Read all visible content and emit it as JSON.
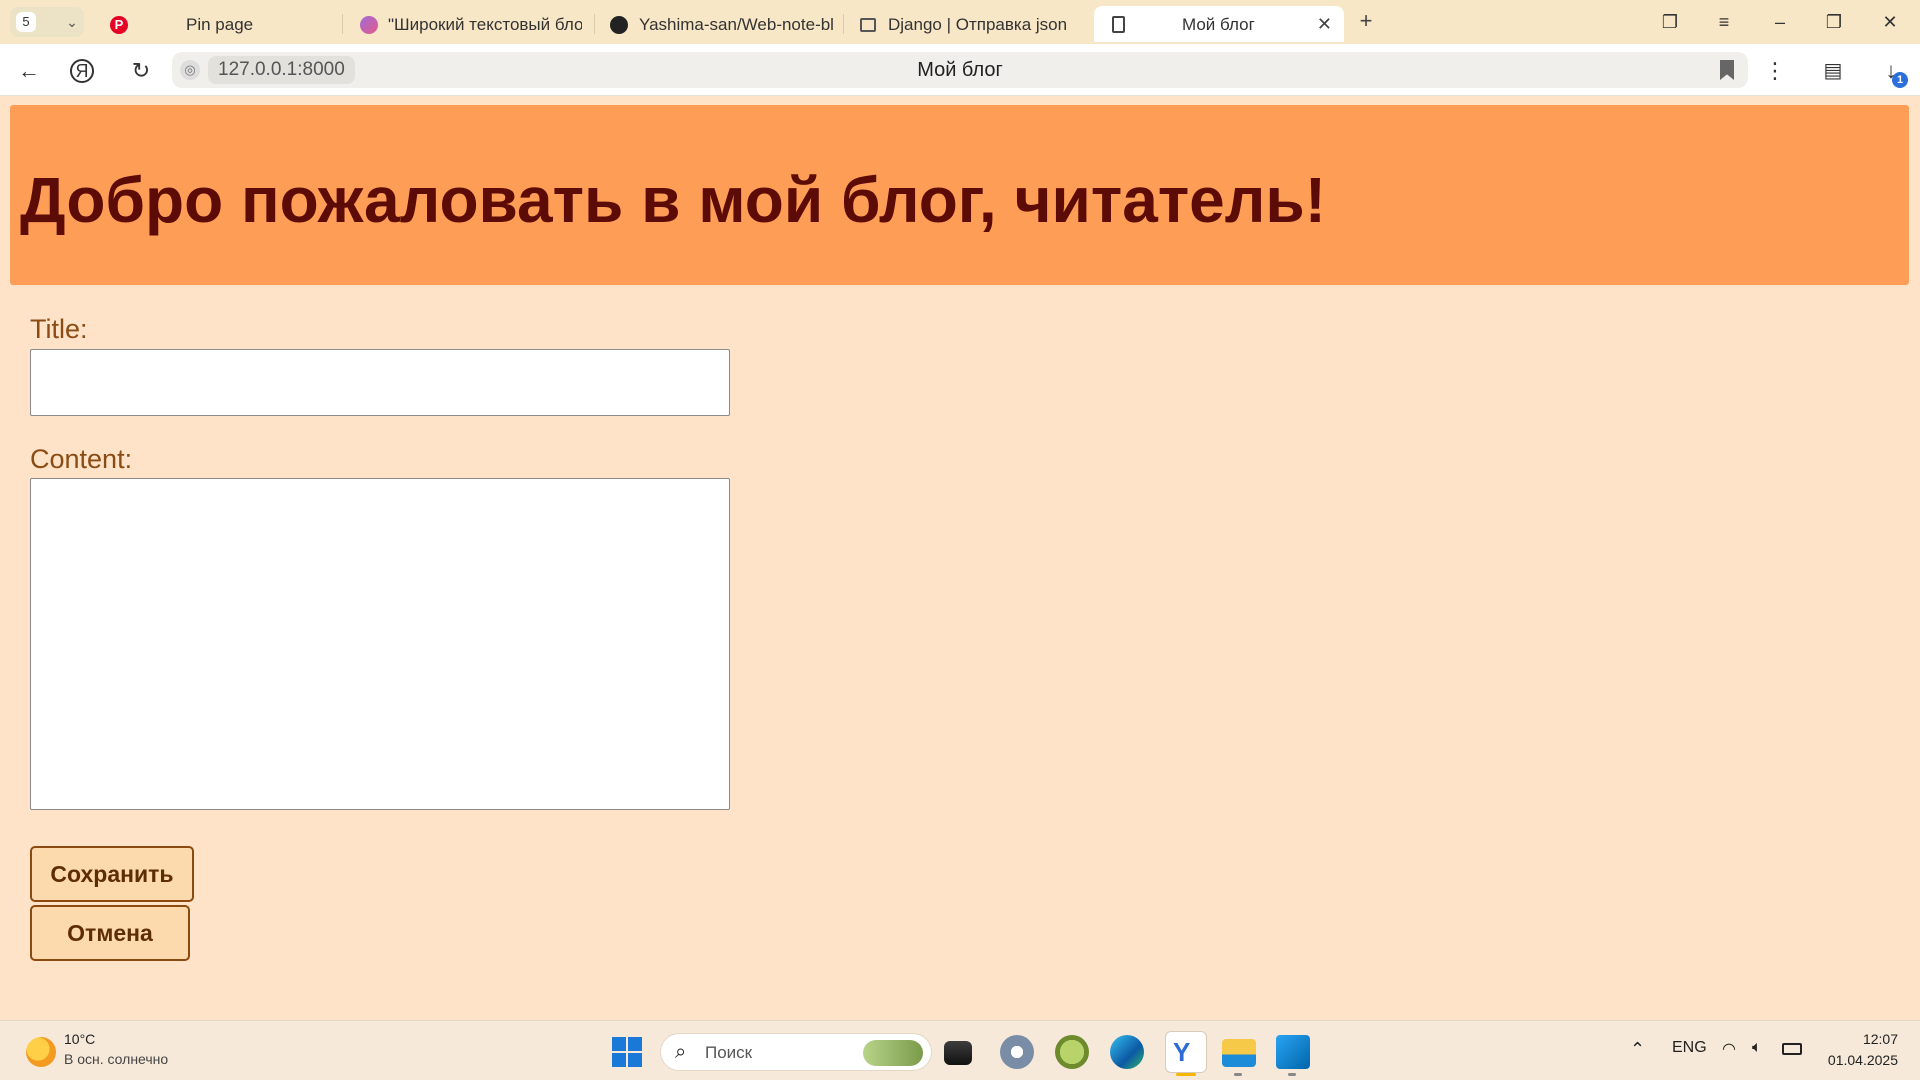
{
  "browser": {
    "tab_count": "5",
    "tabs": [
      {
        "title": "Pin page",
        "icon": "pinterest-icon"
      },
      {
        "title": "\"Широкий текстовый бло",
        "icon": "ai-chat-icon"
      },
      {
        "title": "Yashima-san/Web-note-bl",
        "icon": "github-icon"
      },
      {
        "title": "Django | Отправка json",
        "icon": "gmail-icon"
      },
      {
        "title": "Мой блог",
        "icon": "page-icon",
        "active": true
      }
    ],
    "address": {
      "url": "127.0.0.1:8000",
      "page_title": "Мой блог",
      "download_badge": "1"
    }
  },
  "page": {
    "heading": "Добро пожаловать в мой блог, читатель!",
    "form": {
      "title_label": "Title:",
      "title_value": "",
      "content_label": "Content:",
      "content_value": "",
      "save_label": "Сохранить",
      "cancel_label": "Отмена"
    },
    "colors": {
      "background": "#fee3c8",
      "hero": "#fe9e56",
      "heading": "#5c0b06",
      "label": "#8a4c14",
      "button_border": "#8c4a12"
    }
  },
  "taskbar": {
    "weather_temp": "10°C",
    "weather_desc": "В осн. солнечно",
    "search_placeholder": "Поиск",
    "language": "ENG",
    "time": "12:07",
    "date": "01.04.2025"
  }
}
